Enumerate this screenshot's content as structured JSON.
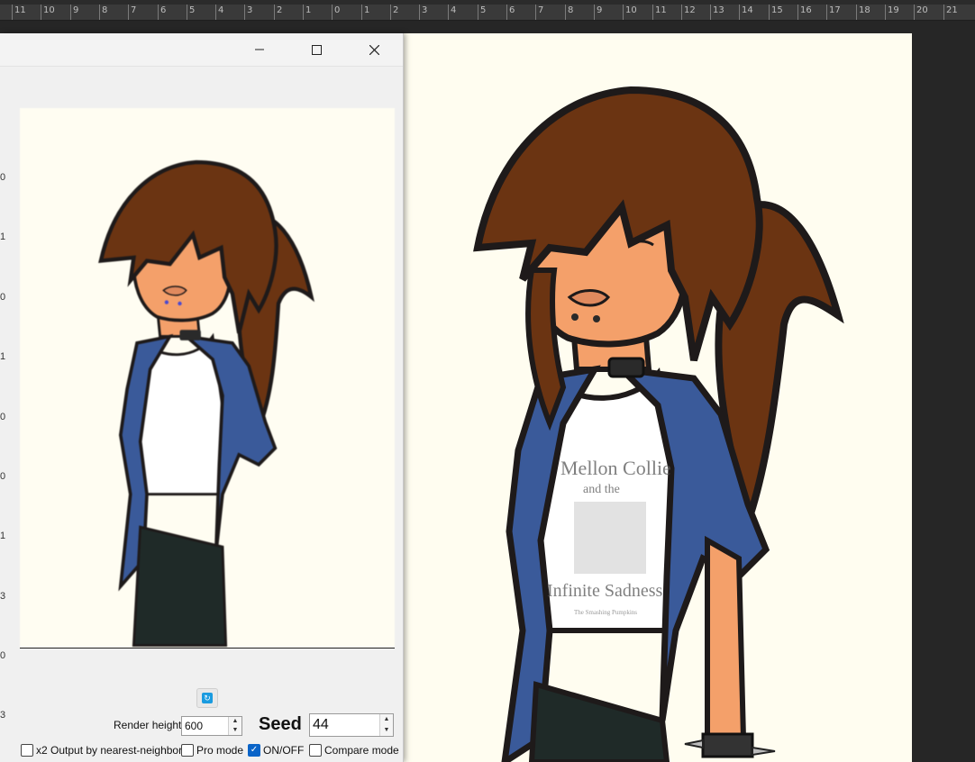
{
  "ruler": {
    "ticks": [
      "11",
      "10",
      "9",
      "8",
      "7",
      "6",
      "5",
      "4",
      "3",
      "2",
      "1",
      "0",
      "1",
      "2",
      "3",
      "4",
      "5",
      "6",
      "7",
      "8",
      "9",
      "10",
      "11",
      "12",
      "13",
      "14",
      "15",
      "16",
      "17",
      "18",
      "19",
      "20",
      "21"
    ]
  },
  "window": {
    "minimize_icon": "minimize-icon",
    "maximize_icon": "maximize-icon",
    "close_icon": "close-icon",
    "side_values": [
      "0",
      "1",
      "0",
      "1",
      "0",
      "0",
      "1",
      "3",
      "0",
      "3"
    ]
  },
  "controls": {
    "render_height_label": "Render height",
    "render_height_value": "600",
    "seed_label": "Seed",
    "seed_value": "44",
    "x2_output_label": "x2 Output by nearest-neighbor",
    "x2_output_checked": false,
    "pro_mode_label": "Pro mode",
    "pro_mode_checked": false,
    "onoff_label": "ON/OFF",
    "onoff_checked": true,
    "compare_mode_label": "Compare mode",
    "compare_mode_checked": false
  },
  "artwork": {
    "shirt_line1": "Mellon Collie",
    "shirt_line2": "and the",
    "shirt_line3": "Infinite Sadness",
    "shirt_line4": "The Smashing Pumpkins"
  },
  "colors": {
    "hair": "#6b3412",
    "skin": "#f4a06a",
    "jacket": "#3a5a9a",
    "outline": "#1e1a1a",
    "canvas_bg": "#fffdf0",
    "checkbox_on": "#0a64c8"
  }
}
